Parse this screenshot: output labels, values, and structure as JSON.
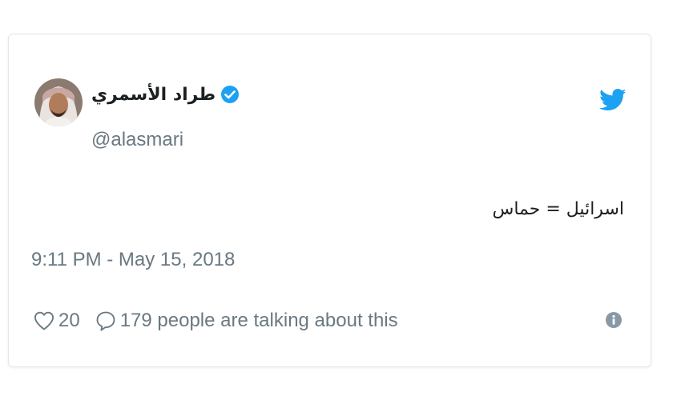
{
  "tweet": {
    "author": {
      "display_name": "طراد الأسمري",
      "handle": "@alasmari",
      "verified": true
    },
    "text": "اسرائيل = حماس",
    "timestamp": "9:11 PM - May 15, 2018",
    "likes_count": "20",
    "talking_text": "179 people are talking about this"
  },
  "icons": {
    "brand": "twitter-bird-icon",
    "verified": "verified-badge-icon",
    "like": "heart-icon",
    "reply": "speech-bubble-icon",
    "info": "info-icon"
  },
  "colors": {
    "twitter_blue": "#1da1f2",
    "secondary_text": "#697882",
    "primary_text": "#1c2022",
    "border": "#e1e8ed"
  }
}
